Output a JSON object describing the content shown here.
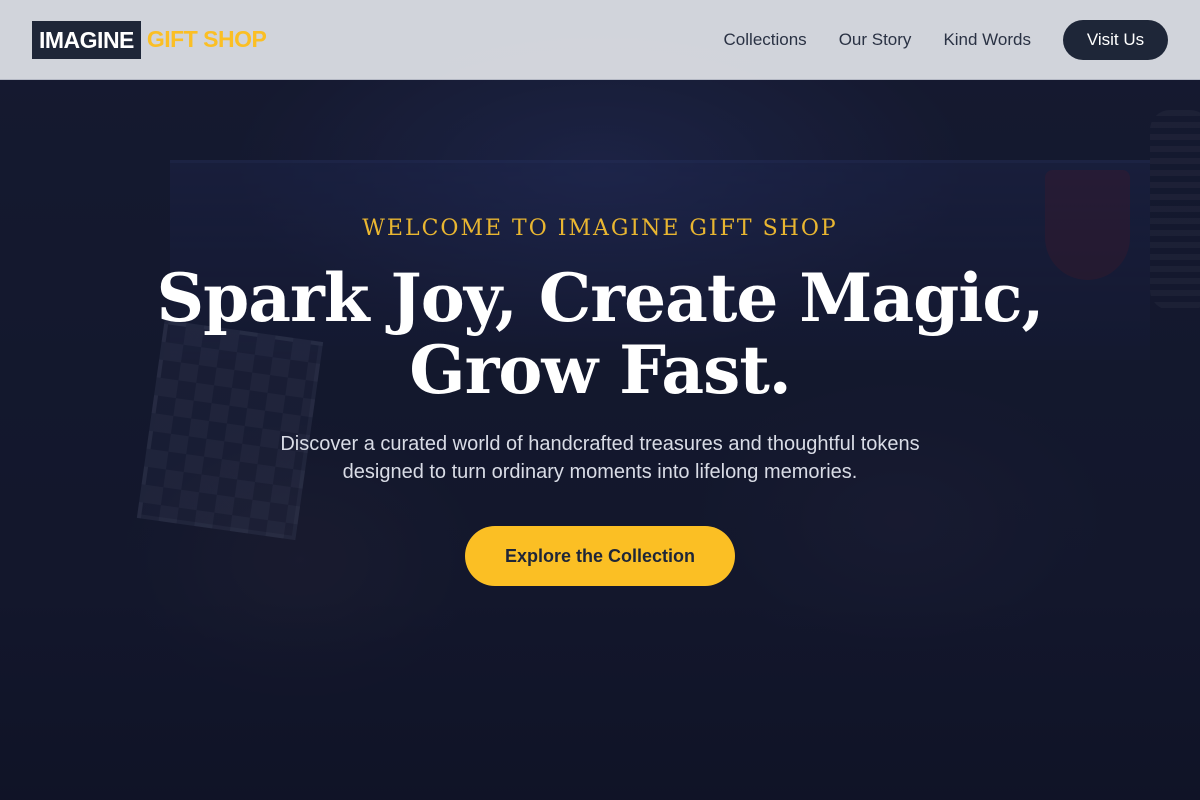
{
  "brand": {
    "name_primary": "IMAGINE",
    "name_accent": "GIFT SHOP"
  },
  "nav": {
    "links": [
      {
        "label": "Collections"
      },
      {
        "label": "Our Story"
      },
      {
        "label": "Kind Words"
      }
    ],
    "cta_label": "Visit Us"
  },
  "hero": {
    "eyebrow": "WELCOME TO IMAGINE GIFT SHOP",
    "headline_line1": "Spark Joy, Create Magic,",
    "headline_line2": "Grow Fast.",
    "description": "Discover a curated world of handcrafted treasures and thoughtful tokens designed to turn ordinary moments into lifelong memories.",
    "cta_label": "Explore the Collection"
  },
  "colors": {
    "accent": "#fbbf24",
    "navy": "#1e2638",
    "hero_bg": "#141a30"
  }
}
